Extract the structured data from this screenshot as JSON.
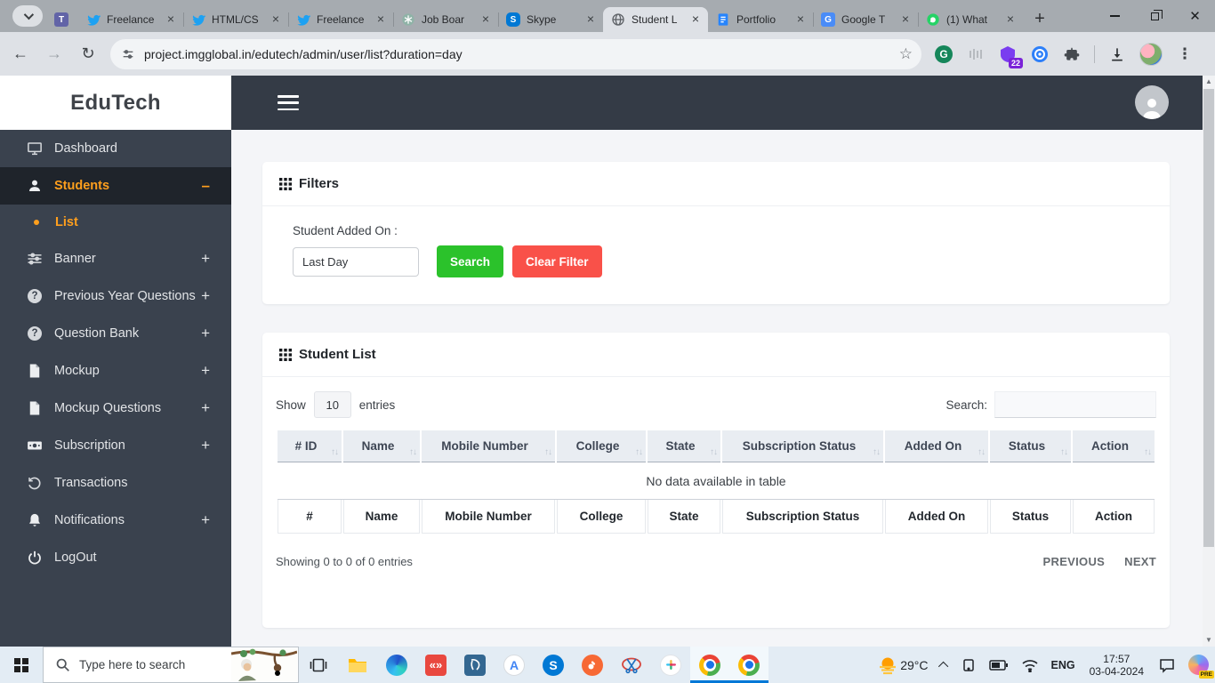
{
  "browser": {
    "tabs": [
      {
        "label": "Freelance",
        "icon": "twitter-icon"
      },
      {
        "label": "HTML/CS",
        "icon": "twitter-icon"
      },
      {
        "label": "Freelance",
        "icon": "twitter-icon"
      },
      {
        "label": "Job Boar",
        "icon": "chatgpt-icon"
      },
      {
        "label": "Skype",
        "icon": "skype-icon"
      },
      {
        "label": "Student L",
        "icon": "globe-icon",
        "active": true
      },
      {
        "label": "Portfolio",
        "icon": "docs-icon"
      },
      {
        "label": "Google T",
        "icon": "translate-icon"
      },
      {
        "label": "(1) What",
        "icon": "whatsapp-icon"
      }
    ],
    "url": "project.imgglobal.in/edutech/admin/user/list?duration=day",
    "extension_badge": "22"
  },
  "sidebar": {
    "brand": "EduTech",
    "items": [
      {
        "label": "Dashboard",
        "toggle": ""
      },
      {
        "label": "Students",
        "toggle": "–"
      },
      {
        "label": "Banner",
        "toggle": "+"
      },
      {
        "label": "Previous Year Questions",
        "toggle": "+"
      },
      {
        "label": "Question Bank",
        "toggle": "+"
      },
      {
        "label": "Mockup",
        "toggle": "+"
      },
      {
        "label": "Mockup Questions",
        "toggle": "+"
      },
      {
        "label": "Subscription",
        "toggle": "+"
      },
      {
        "label": "Transactions",
        "toggle": ""
      },
      {
        "label": "Notifications",
        "toggle": "+"
      },
      {
        "label": "LogOut",
        "toggle": ""
      }
    ],
    "sub_item": {
      "label": "List"
    }
  },
  "filters": {
    "title": "Filters",
    "field_label": "Student Added On :",
    "field_value": "Last Day",
    "search_button": "Search",
    "clear_button": "Clear Filter"
  },
  "student_list": {
    "title": "Student List",
    "show_label": "Show",
    "page_size": "10",
    "entries_label": "entries",
    "search_label": "Search:",
    "search_value": "",
    "columns": [
      "# ID",
      "Name",
      "Mobile Number",
      "College",
      "State",
      "Subscription Status",
      "Added On",
      "Status",
      "Action"
    ],
    "empty_text": "No data available in table",
    "footer_columns": [
      "#",
      "Name",
      "Mobile Number",
      "College",
      "State",
      "Subscription Status",
      "Added On",
      "Status",
      "Action"
    ],
    "info": "Showing 0 to 0 of 0 entries",
    "previous": "PREVIOUS",
    "next": "NEXT"
  },
  "taskbar": {
    "search_placeholder": "Type here to search",
    "temperature": "29°C",
    "language": "ENG",
    "time": "17:57",
    "date": "03-04-2024",
    "copilot_badge": "PRE"
  },
  "colors": {
    "accent_orange": "#ff9f1d",
    "button_green": "#2bc22b",
    "button_red": "#f95149",
    "sidebar_dark": "#3a424e",
    "topbar_dark": "#343b46",
    "taskbar_blue": "#e3ecf4"
  }
}
